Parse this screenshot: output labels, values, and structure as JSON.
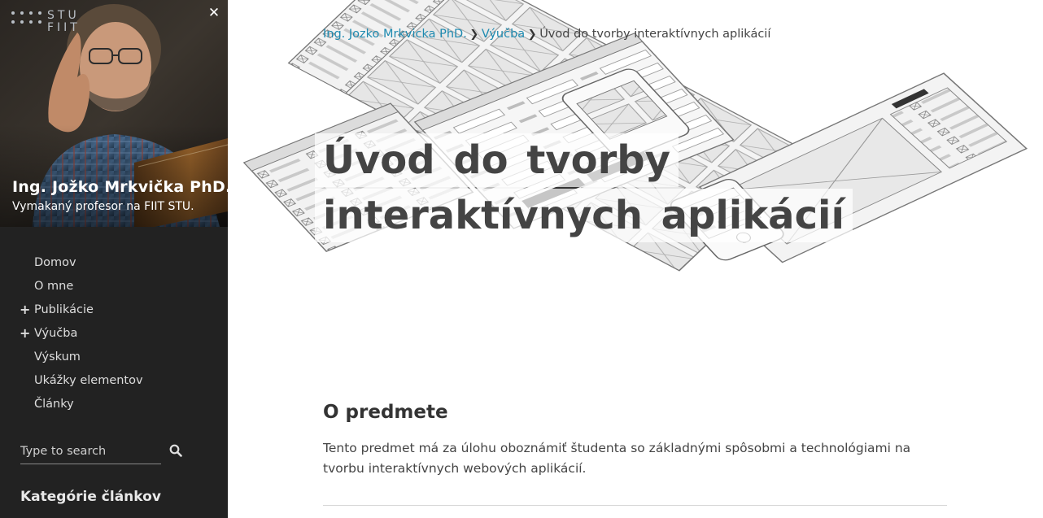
{
  "sidebar": {
    "logo": {
      "line1": "STU",
      "line2": "FIIT"
    },
    "close_icon": "close-icon",
    "author_name": "Ing. Jožko Mrkvička PhD.",
    "author_subtitle": "Vymakaný profesor na FIIT STU.",
    "nav": [
      {
        "label": "Domov",
        "expandable": false
      },
      {
        "label": "O mne",
        "expandable": false
      },
      {
        "label": "Publikácie",
        "expandable": true
      },
      {
        "label": "Výučba",
        "expandable": true
      },
      {
        "label": "Výskum",
        "expandable": false
      },
      {
        "label": "Ukážky elementov",
        "expandable": false
      },
      {
        "label": "Články",
        "expandable": false
      }
    ],
    "expand_symbol": "+",
    "search": {
      "placeholder": "Type to search",
      "icon": "search-icon"
    },
    "categories_heading": "Kategórie článkov"
  },
  "breadcrumb": {
    "items": [
      "Ing. Jozko Mrkvicka PhD.",
      "Výučba"
    ],
    "current": "Úvod do tvorby interaktívnych aplikácií",
    "separator": "❯"
  },
  "page": {
    "title_line1": "Úvod do tvorby",
    "title_line2": "interaktívnych aplikácií"
  },
  "section": {
    "heading": "O predmete",
    "text": "Tento predmet má za úlohu oboznámiť študenta so základnými spôsobmi a technológiami na tvorbu interaktívnych webových aplikácií."
  },
  "colors": {
    "sidebar_bg": "#222222",
    "link": "#1e8ab0",
    "title": "#444444"
  }
}
